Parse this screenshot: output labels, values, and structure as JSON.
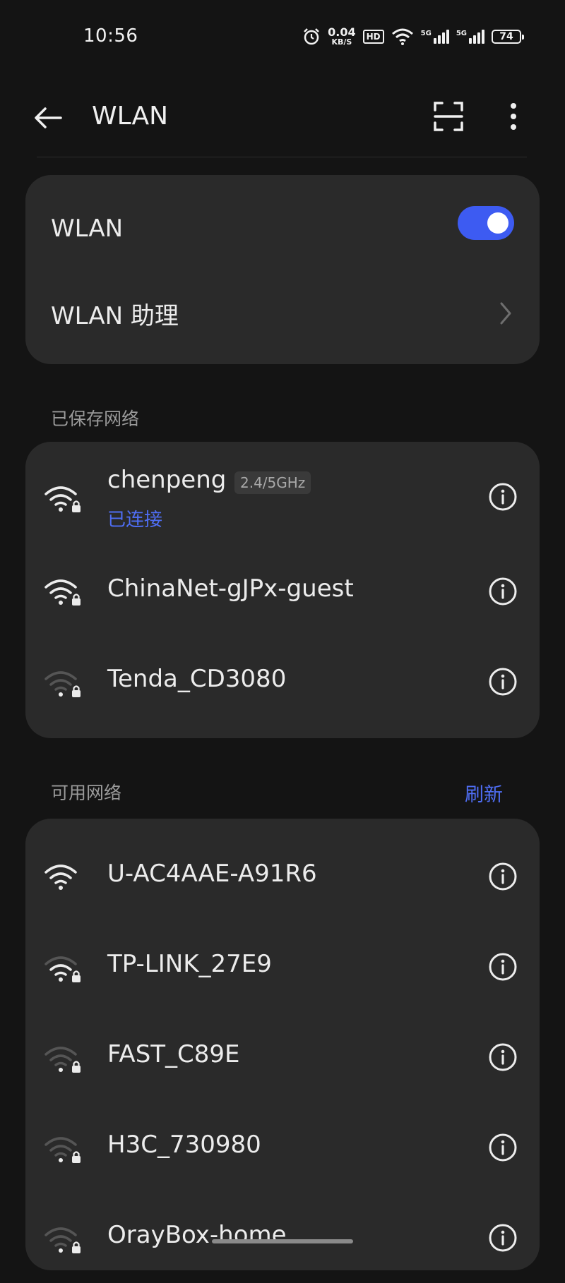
{
  "status_bar": {
    "time": "10:56",
    "net_speed_value": "0.04",
    "net_speed_unit": "KB/S",
    "hd_label": "HD",
    "sim1_label": "5G",
    "sim2_label": "5G",
    "battery": "74"
  },
  "header": {
    "title": "WLAN"
  },
  "wlan_card": {
    "toggle_label": "WLAN",
    "toggle_on": true,
    "assistant_label": "WLAN 助理"
  },
  "saved_section": {
    "label": "已保存网络",
    "networks": [
      {
        "name": "chenpeng",
        "band": "2.4/5GHz",
        "status": "已连接",
        "signal": "strong",
        "locked": true
      },
      {
        "name": "ChinaNet-gJPx-guest",
        "signal": "strong",
        "locked": true
      },
      {
        "name": "Tenda_CD3080",
        "signal": "weak",
        "locked": true
      }
    ]
  },
  "available_section": {
    "label": "可用网络",
    "refresh_label": "刷新",
    "networks": [
      {
        "name": "U-AC4AAE-A91R6",
        "signal": "strong",
        "locked": false
      },
      {
        "name": "TP-LINK_27E9",
        "signal": "medium",
        "locked": true
      },
      {
        "name": "FAST_C89E",
        "signal": "weak",
        "locked": true
      },
      {
        "name": "H3C_730980",
        "signal": "weak",
        "locked": true
      },
      {
        "name": "OrayBox-home",
        "signal": "weak",
        "locked": true
      }
    ]
  },
  "colors": {
    "accent": "#3d5bf2",
    "link": "#4f6ef5",
    "card": "#2a2a2a",
    "background": "#141414"
  }
}
